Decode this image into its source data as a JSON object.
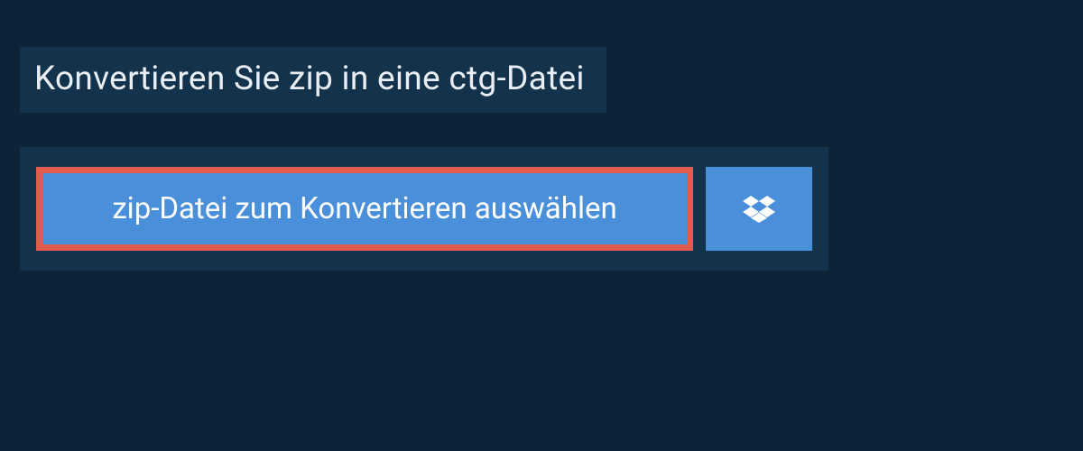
{
  "header": {
    "title": "Konvertieren Sie zip in eine ctg-Datei"
  },
  "actions": {
    "select_file_label": "zip-Datei zum Konvertieren auswählen"
  }
}
